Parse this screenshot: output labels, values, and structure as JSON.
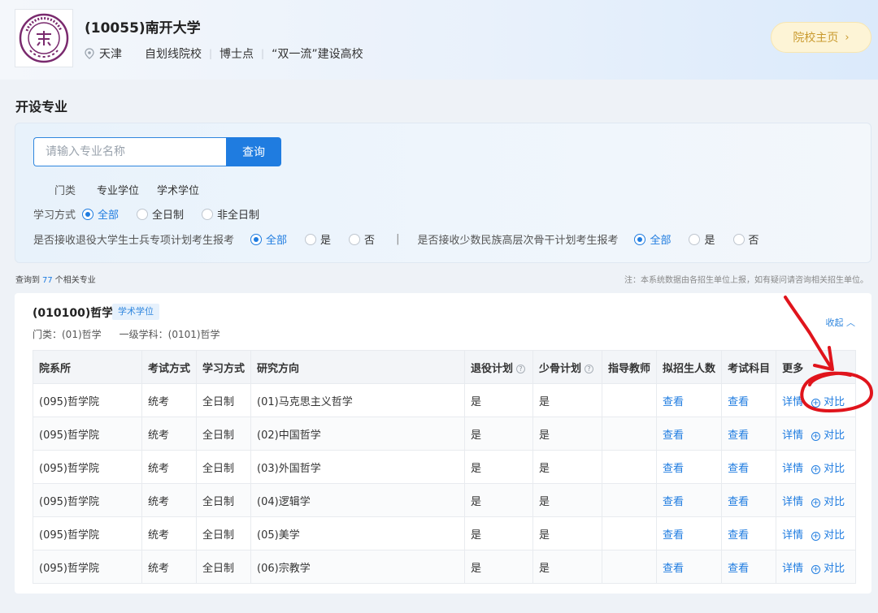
{
  "header": {
    "name": "(10055)南开大学",
    "location": "天津",
    "tags": [
      "自划线院校",
      "博士点",
      "“双一流”建设高校"
    ],
    "home_button": "院校主页",
    "logo_text": "NANKAI UNIVERSITY 1919"
  },
  "section_title": "开设专业",
  "filter": {
    "search_placeholder": "请输入专业名称",
    "search_button": "查询",
    "category_label": "门类",
    "categories": [
      "专业学位",
      "学术学位"
    ],
    "study_mode_label": "学习方式",
    "study_modes": [
      "全部",
      "全日制",
      "非全日制"
    ],
    "veteran_label": "是否接收退役大学生士兵专项计划考生报考",
    "veteran_options": [
      "全部",
      "是",
      "否"
    ],
    "separator": "|",
    "minority_label": "是否接收少数民族高层次骨干计划考生报考",
    "minority_options": [
      "全部",
      "是",
      "否"
    ]
  },
  "results": {
    "prefix": "查询到",
    "count": "77",
    "suffix": "个相关专业",
    "note": "注：本系统数据由各招生单位上报，如有疑问请咨询相关招生单位。"
  },
  "major": {
    "title": "(010100)哲学",
    "badge": "学术学位",
    "collapse": "收起",
    "category": "门类：(01)哲学",
    "discipline": "一级学科：(0101)哲学"
  },
  "table": {
    "headers": [
      "院系所",
      "考试方式",
      "学习方式",
      "研究方向",
      "退役计划",
      "少骨计划",
      "指导教师",
      "拟招生人数",
      "考试科目",
      "更多"
    ],
    "view_label": "查看",
    "detail_label": "详情",
    "compare_label": "对比",
    "rows": [
      {
        "dept": "(095)哲学院",
        "exam": "统考",
        "mode": "全日制",
        "direction": "(01)马克思主义哲学",
        "veteran": "是",
        "minority": "是",
        "tutor": ""
      },
      {
        "dept": "(095)哲学院",
        "exam": "统考",
        "mode": "全日制",
        "direction": "(02)中国哲学",
        "veteran": "是",
        "minority": "是",
        "tutor": ""
      },
      {
        "dept": "(095)哲学院",
        "exam": "统考",
        "mode": "全日制",
        "direction": "(03)外国哲学",
        "veteran": "是",
        "minority": "是",
        "tutor": ""
      },
      {
        "dept": "(095)哲学院",
        "exam": "统考",
        "mode": "全日制",
        "direction": "(04)逻辑学",
        "veteran": "是",
        "minority": "是",
        "tutor": ""
      },
      {
        "dept": "(095)哲学院",
        "exam": "统考",
        "mode": "全日制",
        "direction": "(05)美学",
        "veteran": "是",
        "minority": "是",
        "tutor": ""
      },
      {
        "dept": "(095)哲学院",
        "exam": "统考",
        "mode": "全日制",
        "direction": "(06)宗教学",
        "veteran": "是",
        "minority": "是",
        "tutor": ""
      }
    ]
  },
  "colors": {
    "accent": "#1f7ce0",
    "annotation": "#e0141c",
    "home_button_bg": "#fdf4d6",
    "logo_purple": "#7a2a6e"
  }
}
